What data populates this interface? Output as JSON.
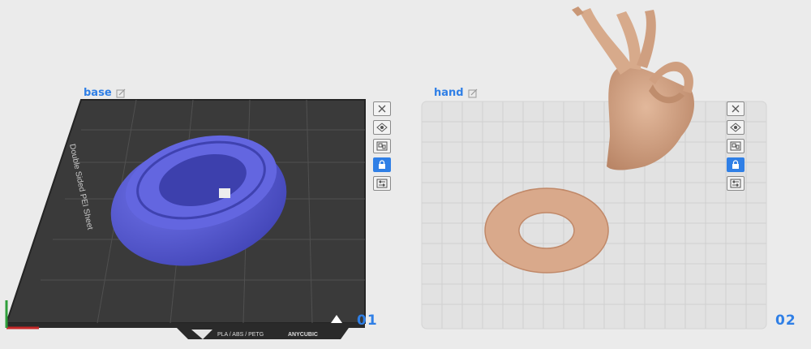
{
  "plates": [
    {
      "name": "base",
      "number": "01",
      "sheet_text": "Double Sided PEI Sheet",
      "material_text": "PLA / ABS / PETG",
      "brand_text": "ANYCUBIC"
    },
    {
      "name": "hand",
      "number": "02"
    }
  ],
  "tool_icons": [
    "close-icon",
    "orient-icon",
    "arrange-icon",
    "lock-icon",
    "settings-icon"
  ],
  "colors": {
    "accent": "#2f7fe6",
    "dark_plate": "#3a3a3a",
    "light_plate": "#e2e2e2",
    "model_base": "#5c5fd8",
    "model_hand": "#d9a98b"
  }
}
